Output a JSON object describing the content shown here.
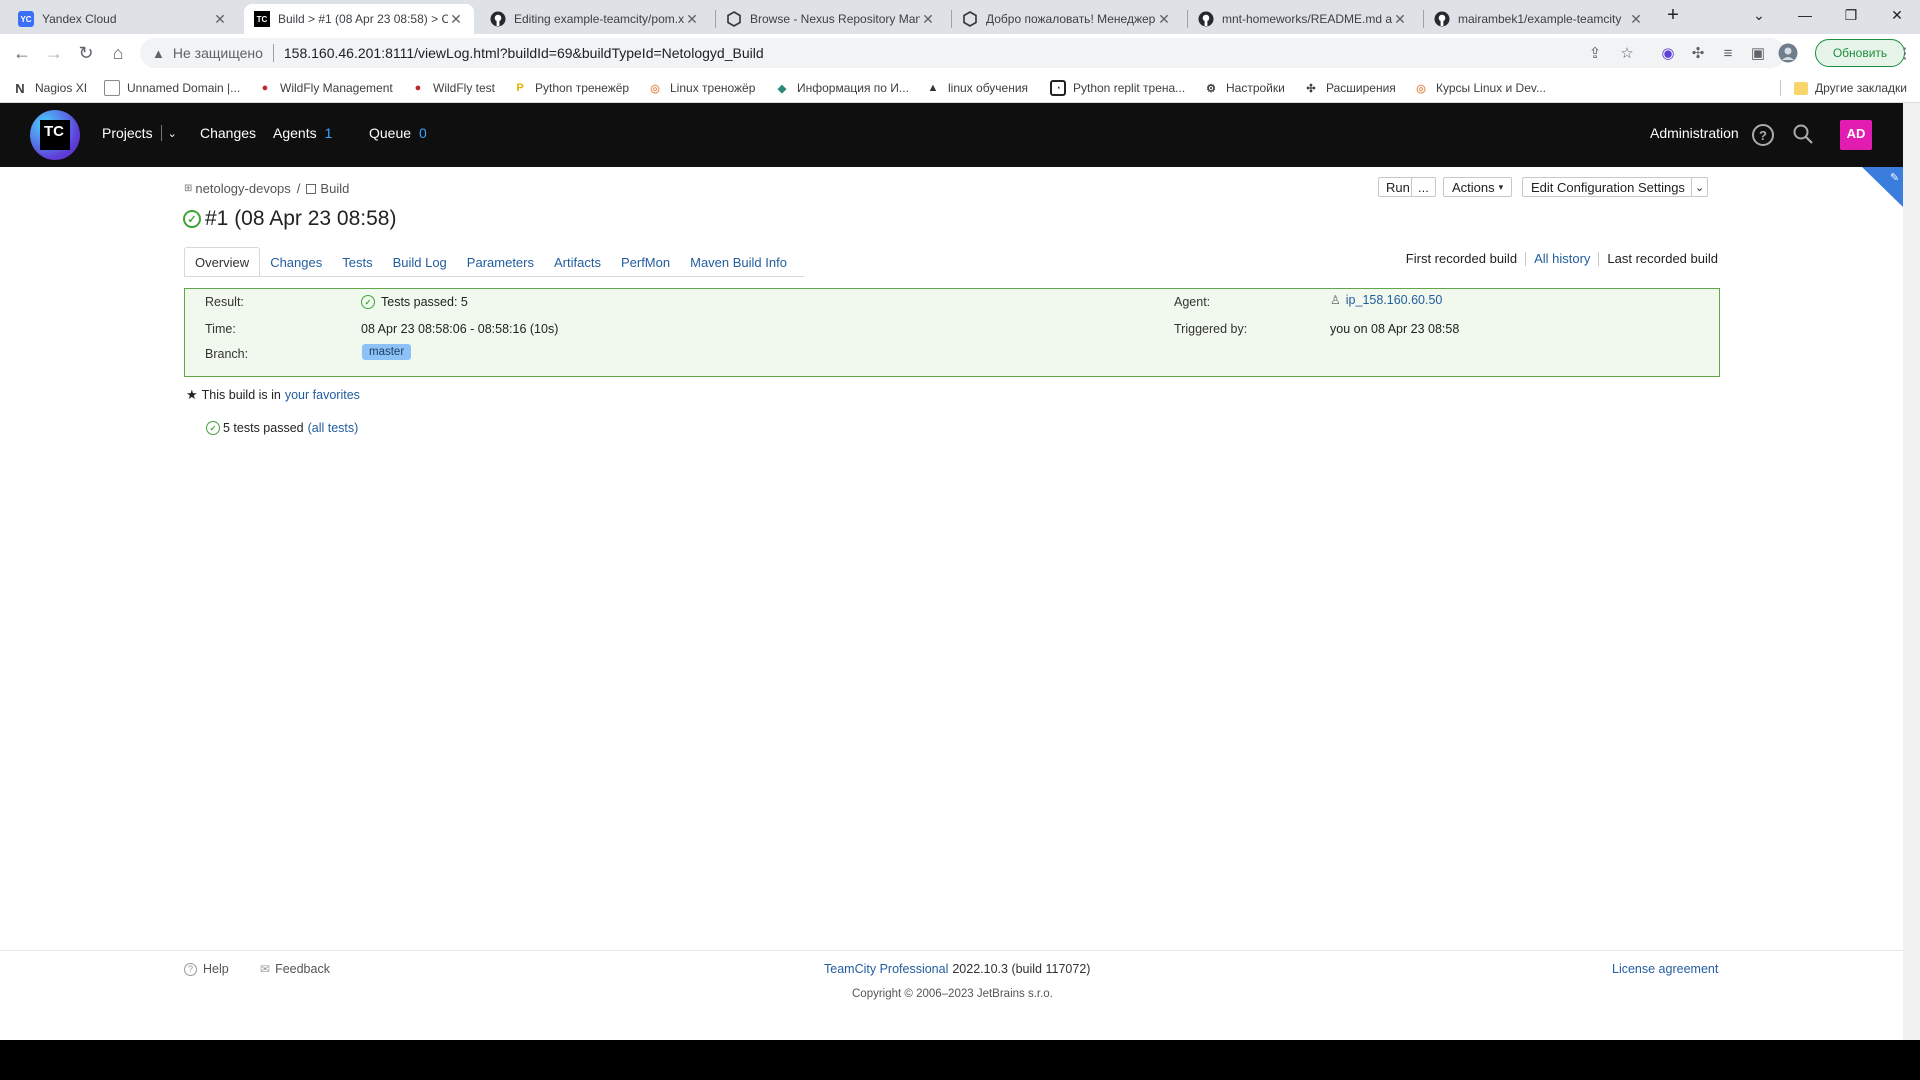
{
  "browser": {
    "tabs": [
      {
        "title": "Yandex Cloud",
        "icon": "yandex-cloud-icon",
        "icon_text": "YC"
      },
      {
        "title": "Build > #1 (08 Apr 23 08:58) > C",
        "icon": "teamcity-icon",
        "icon_text": "TC"
      },
      {
        "title": "Editing example-teamcity/pom.x",
        "icon": "github-icon"
      },
      {
        "title": "Browse - Nexus Repository Man",
        "icon": "nexus-icon"
      },
      {
        "title": "Добро пожаловать! Менеджер",
        "icon": "nexus-icon"
      },
      {
        "title": "mnt-homeworks/README.md at",
        "icon": "github-icon"
      },
      {
        "title": "mairambek1/example-teamcity",
        "icon": "github-icon"
      }
    ],
    "address": {
      "security_label": "Не защищено",
      "url": "158.160.46.201:8111/viewLog.html?buildId=69&buildTypeId=Netologyd_Build"
    },
    "update_label": "Обновить",
    "bookmarks": [
      {
        "label": "Nagios XI",
        "icon_text": "N"
      },
      {
        "label": "Unnamed Domain |..."
      },
      {
        "label": "WildFly Management"
      },
      {
        "label": "WildFly test"
      },
      {
        "label": "Python тренежёр",
        "icon_text": "P"
      },
      {
        "label": "Linux треножёр"
      },
      {
        "label": "Информация по И..."
      },
      {
        "label": "linux обучения"
      },
      {
        "label": "Python replit трена..."
      },
      {
        "label": "Настройки"
      },
      {
        "label": "Расширения"
      },
      {
        "label": "Курсы Linux и Dev..."
      }
    ],
    "other_bookmarks": "Другие закладки"
  },
  "header": {
    "logo_text": "TC",
    "projects": "Projects",
    "changes": "Changes",
    "agents": "Agents",
    "agents_count": "1",
    "queue": "Queue",
    "queue_count": "0",
    "administration": "Administration",
    "avatar": "AD"
  },
  "breadcrumb": {
    "project": "netology-devops",
    "separator": "/",
    "build_config": "Build"
  },
  "build": {
    "title": "#1 (08 Apr 23 08:58)",
    "run": "Run",
    "run_more": "...",
    "actions": "Actions",
    "edit_settings": "Edit Configuration Settings"
  },
  "tabs": [
    "Overview",
    "Changes",
    "Tests",
    "Build Log",
    "Parameters",
    "Artifacts",
    "PerfMon",
    "Maven Build Info"
  ],
  "history": {
    "first": "First recorded build",
    "all": "All history",
    "last": "Last recorded build"
  },
  "summary": {
    "result_label": "Result:",
    "result_value": "Tests passed: 5",
    "time_label": "Time:",
    "time_value": "08 Apr 23 08:58:06 - 08:58:16 (10s)",
    "branch_label": "Branch:",
    "branch_value": "master",
    "agent_label": "Agent:",
    "agent_value": "ip_158.160.60.50",
    "triggered_label": "Triggered by:",
    "triggered_value": "you on 08 Apr 23 08:58"
  },
  "favorites": {
    "text": "This build is in",
    "link": "your favorites"
  },
  "tests": {
    "text": "5 tests passed",
    "link": "(all tests)"
  },
  "footer": {
    "help": "Help",
    "feedback": "Feedback",
    "product_link": "TeamCity Professional",
    "version": "2022.10.3 (build 117072)",
    "copyright": "Copyright © 2006–2023 JetBrains s.r.o.",
    "license": "License agreement"
  },
  "colors": {
    "success": "#3fa33a",
    "link": "#235d9e",
    "avatar": "#e21cb1",
    "header_bg": "#0f0f0f"
  }
}
